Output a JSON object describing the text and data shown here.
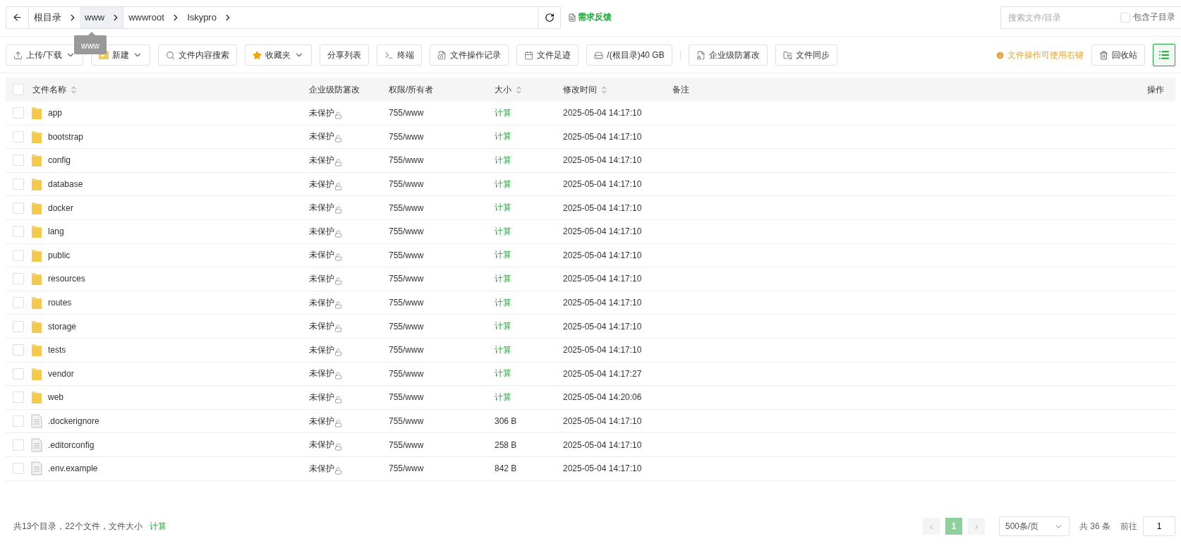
{
  "path_bar": {
    "crumbs": [
      {
        "label": "根目录",
        "highlighted": false
      },
      {
        "label": "www",
        "highlighted": true
      },
      {
        "label": "wwwroot",
        "highlighted": false
      },
      {
        "label": "lskypro",
        "highlighted": false
      }
    ],
    "tooltip": "www"
  },
  "feedback": "需求反馈",
  "search": {
    "placeholder": "搜索文件/目录",
    "include_subdirs": {
      "label": "包含子目录",
      "checked": false
    }
  },
  "toolbar": {
    "buttons": [
      {
        "label": "上传/下载",
        "dropdown": true
      },
      {
        "label": "新建",
        "dropdown": true
      },
      {
        "label": "文件内容搜索",
        "dropdown": false
      },
      {
        "label": "收藏夹",
        "dropdown": true
      },
      {
        "label": "分享列表",
        "dropdown": false
      },
      {
        "label": "终端",
        "dropdown": false
      },
      {
        "label": "文件操作记录",
        "dropdown": false
      },
      {
        "label": "文件足迹",
        "dropdown": false
      },
      {
        "label": "/(根目录)40 GB",
        "dropdown": false
      }
    ],
    "right_buttons": [
      {
        "label": "企业级防篡改"
      },
      {
        "label": "文件同步"
      }
    ],
    "hint": "文件操作可使用右键",
    "recycle": "回收站",
    "list_view": {
      "selected": true
    }
  },
  "table": {
    "select_all": {
      "checked": false
    },
    "columns": [
      {
        "label": "文件名称",
        "sortable": true
      },
      {
        "label": "企业级防篡改",
        "sortable": false
      },
      {
        "label": "权限/所有者",
        "sortable": false
      },
      {
        "label": "大小",
        "sortable": true
      },
      {
        "label": "修改时间",
        "sortable": true
      },
      {
        "label": "备注",
        "sortable": false
      },
      {
        "label": "操作",
        "sortable": false
      }
    ],
    "rows": [
      {
        "kind": "folder",
        "name": "app",
        "protect": "未保护",
        "perm": "755/www",
        "size": "计算",
        "time": "2025-05-04 14:17:10",
        "checked": false
      },
      {
        "kind": "folder",
        "name": "bootstrap",
        "protect": "未保护",
        "perm": "755/www",
        "size": "计算",
        "time": "2025-05-04 14:17:10",
        "checked": false
      },
      {
        "kind": "folder",
        "name": "config",
        "protect": "未保护",
        "perm": "755/www",
        "size": "计算",
        "time": "2025-05-04 14:17:10",
        "checked": false
      },
      {
        "kind": "folder",
        "name": "database",
        "protect": "未保护",
        "perm": "755/www",
        "size": "计算",
        "time": "2025-05-04 14:17:10",
        "checked": false
      },
      {
        "kind": "folder",
        "name": "docker",
        "protect": "未保护",
        "perm": "755/www",
        "size": "计算",
        "time": "2025-05-04 14:17:10",
        "checked": false
      },
      {
        "kind": "folder",
        "name": "lang",
        "protect": "未保护",
        "perm": "755/www",
        "size": "计算",
        "time": "2025-05-04 14:17:10",
        "checked": false
      },
      {
        "kind": "folder",
        "name": "public",
        "protect": "未保护",
        "perm": "755/www",
        "size": "计算",
        "time": "2025-05-04 14:17:10",
        "checked": false
      },
      {
        "kind": "folder",
        "name": "resources",
        "protect": "未保护",
        "perm": "755/www",
        "size": "计算",
        "time": "2025-05-04 14:17:10",
        "checked": false
      },
      {
        "kind": "folder",
        "name": "routes",
        "protect": "未保护",
        "perm": "755/www",
        "size": "计算",
        "time": "2025-05-04 14:17:10",
        "checked": false
      },
      {
        "kind": "folder",
        "name": "storage",
        "protect": "未保护",
        "perm": "755/www",
        "size": "计算",
        "time": "2025-05-04 14:17:10",
        "checked": false
      },
      {
        "kind": "folder",
        "name": "tests",
        "protect": "未保护",
        "perm": "755/www",
        "size": "计算",
        "time": "2025-05-04 14:17:10",
        "checked": false
      },
      {
        "kind": "folder",
        "name": "vendor",
        "protect": "未保护",
        "perm": "755/www",
        "size": "计算",
        "time": "2025-05-04 14:17:27",
        "checked": false
      },
      {
        "kind": "folder",
        "name": "web",
        "protect": "未保护",
        "perm": "755/www",
        "size": "计算",
        "time": "2025-05-04 14:20:06",
        "checked": false
      },
      {
        "kind": "file",
        "name": ".dockerignore",
        "protect": "未保护",
        "perm": "755/www",
        "size": "306 B",
        "time": "2025-05-04 14:17:10",
        "checked": false
      },
      {
        "kind": "file",
        "name": ".editorconfig",
        "protect": "未保护",
        "perm": "755/www",
        "size": "258 B",
        "time": "2025-05-04 14:17:10",
        "checked": false
      },
      {
        "kind": "file",
        "name": ".env.example",
        "protect": "未保护",
        "perm": "755/www",
        "size": "842 B",
        "time": "2025-05-04 14:17:10",
        "checked": false
      }
    ]
  },
  "footer": {
    "summary": "共13个目录，22个文件，文件大小",
    "calc": "计算",
    "pagination": {
      "prev": "‹",
      "pages": [
        {
          "label": "1",
          "selected": true
        }
      ],
      "next": "›",
      "page_size": "500条/页",
      "total": "共 36 条",
      "goto": "前往",
      "goto_value": "1"
    }
  }
}
